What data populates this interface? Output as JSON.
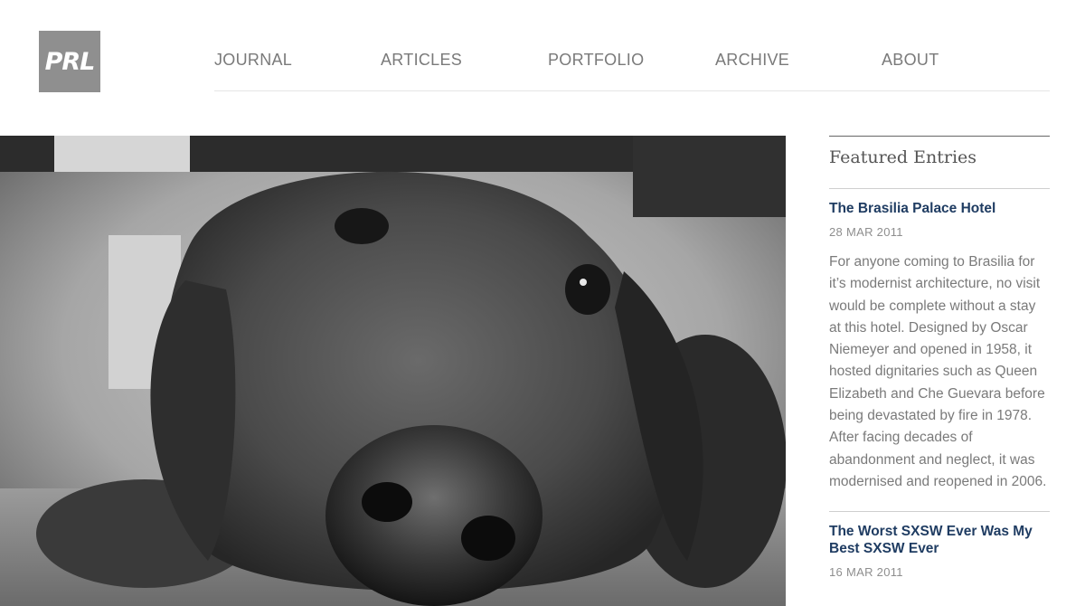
{
  "logo": {
    "text": "PRL"
  },
  "nav": {
    "items": [
      {
        "label": "JOURNAL"
      },
      {
        "label": "ARTICLES"
      },
      {
        "label": "PORTFOLIO"
      },
      {
        "label": "ARCHIVE"
      },
      {
        "label": "ABOUT"
      }
    ]
  },
  "hero": {
    "subject": "black-and-white close-up photo of a dog resting its head on the floor"
  },
  "sidebar": {
    "heading": "Featured Entries",
    "entries": [
      {
        "title": "The Brasilia Palace Hotel",
        "date": "28 MAR 2011",
        "excerpt": "For anyone coming to Brasilia for it’s modernist architecture, no visit would be complete without a stay at this hotel. Designed by Oscar Niemeyer and opened in 1958, it hosted dignitaries such as Queen Elizabeth and Che Guevara before being devastated by fire in 1978. After facing decades of abandonment and neglect, it was modernised and reopened in 2006."
      },
      {
        "title": "The Worst SXSW Ever Was My Best SXSW Ever",
        "date": "16 MAR 2011"
      }
    ]
  }
}
